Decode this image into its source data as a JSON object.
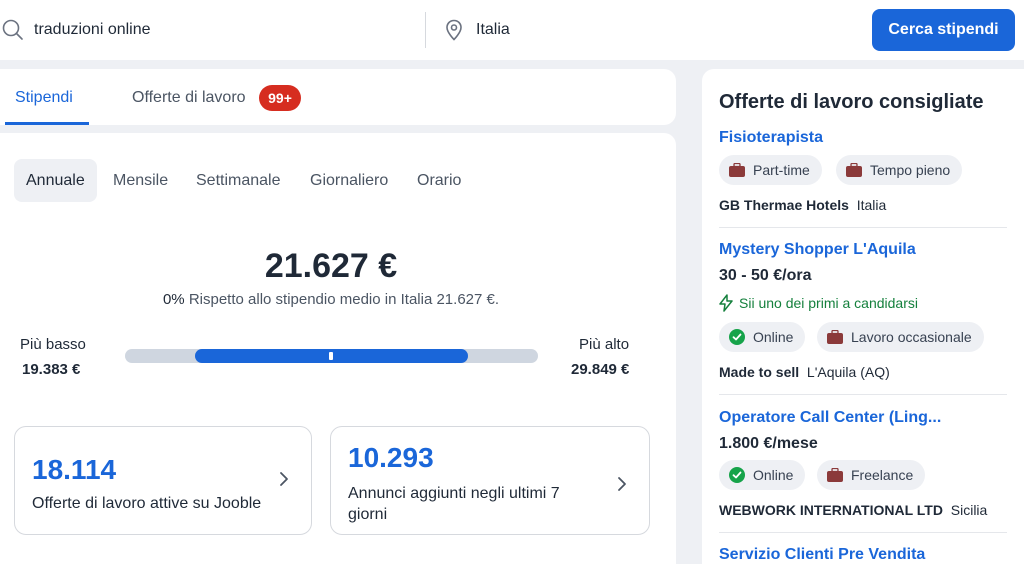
{
  "search": {
    "query": "traduzioni online",
    "location": "Italia",
    "button_label": "Cerca stipendi"
  },
  "tabs": [
    {
      "label": "Stipendi"
    },
    {
      "label": "Offerte di lavoro",
      "badge": "99+"
    }
  ],
  "periods": [
    "Annuale",
    "Mensile",
    "Settimanale",
    "Giornaliero",
    "Orario"
  ],
  "salary": {
    "amount": "21.627 €",
    "compare_pct": "0%",
    "compare_text": " Rispetto allo stipendio medio in Italia 21.627 €.",
    "low_label": "Più basso",
    "low_value": "19.383 €",
    "high_label": "Più alto",
    "high_value": "29.849 €"
  },
  "stats": [
    {
      "number": "18.114",
      "text": "Offerte di lavoro attive su Jooble"
    },
    {
      "number": "10.293",
      "text": "Annunci aggiunti negli ultimi 7 giorni"
    }
  ],
  "sidebar": {
    "title": "Offerte di lavoro consigliate",
    "early_text": "Sii uno dei primi a candidarsi",
    "jobs": [
      {
        "title": "Fisioterapista",
        "chips": [
          "Part-time",
          "Tempo pieno"
        ],
        "company": "GB Thermae Hotels",
        "location": "Italia"
      },
      {
        "title": "Mystery Shopper L'Aquila",
        "salary": "30 - 50 €/ora",
        "chips": [
          "Online",
          "Lavoro occasionale"
        ],
        "company": "Made to sell",
        "location": "L'Aquila (AQ)"
      },
      {
        "title": "Operatore Call Center (Ling...",
        "salary": "1.800 €/mese",
        "chips": [
          "Online",
          "Freelance"
        ],
        "company": "WEBWORK INTERNATIONAL LTD",
        "location": "Sicilia"
      },
      {
        "title": "Servizio Clienti Pre Vendita"
      }
    ]
  },
  "colors": {
    "accent": "#1a66d9",
    "badge": "#d62d20",
    "success": "#15803d",
    "briefcase": "#8b3a3a"
  }
}
